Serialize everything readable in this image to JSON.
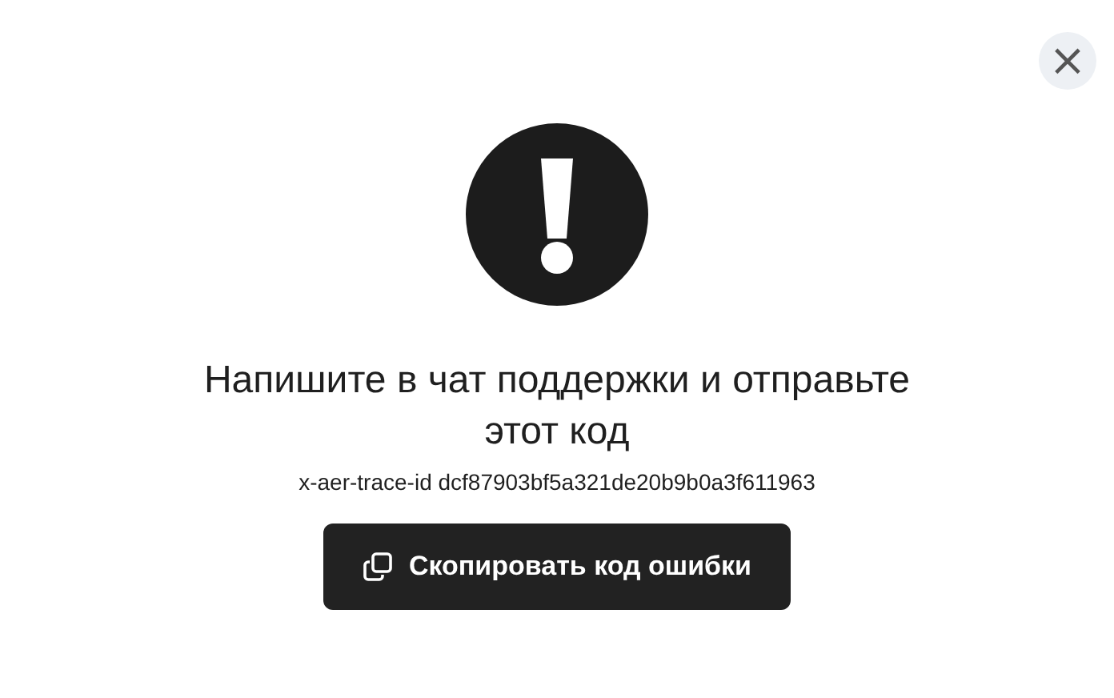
{
  "close_button": {
    "label": "×"
  },
  "message": "Напишите в чат поддержки и отправьте этот код",
  "trace_id": "x-aer-trace-id dcf87903bf5a321de20b9b0a3f611963",
  "copy_button": {
    "label": "Скопировать код ошибки"
  }
}
